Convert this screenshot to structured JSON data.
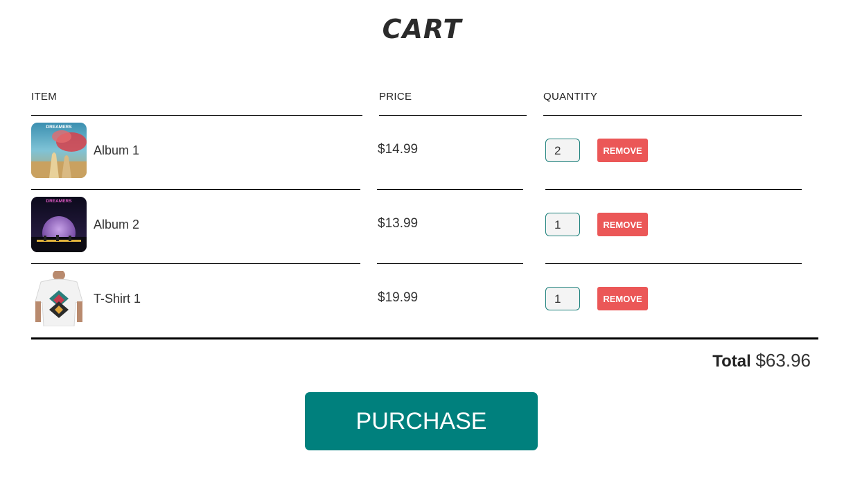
{
  "title": "CART",
  "columns": {
    "item": "ITEM",
    "price": "PRICE",
    "quantity": "QUANTITY"
  },
  "items": [
    {
      "name": "Album 1",
      "price": "$14.99",
      "quantity": "2",
      "remove_label": "REMOVE",
      "image_icon": "album-cover-dreamers-icon",
      "cover_text": "DREAMERS"
    },
    {
      "name": "Album 2",
      "price": "$13.99",
      "quantity": "1",
      "remove_label": "REMOVE",
      "image_icon": "album-cover-moon-icon",
      "cover_text": "DREAMERS"
    },
    {
      "name": "T-Shirt 1",
      "price": "$19.99",
      "quantity": "1",
      "remove_label": "REMOVE",
      "image_icon": "t-shirt-photo-icon"
    }
  ],
  "total": {
    "label": "Total",
    "value": "$63.96"
  },
  "purchase_label": "PURCHASE",
  "colors": {
    "accent": "#00807d",
    "remove": "#eb5757",
    "input_border": "#1a7f7a"
  }
}
